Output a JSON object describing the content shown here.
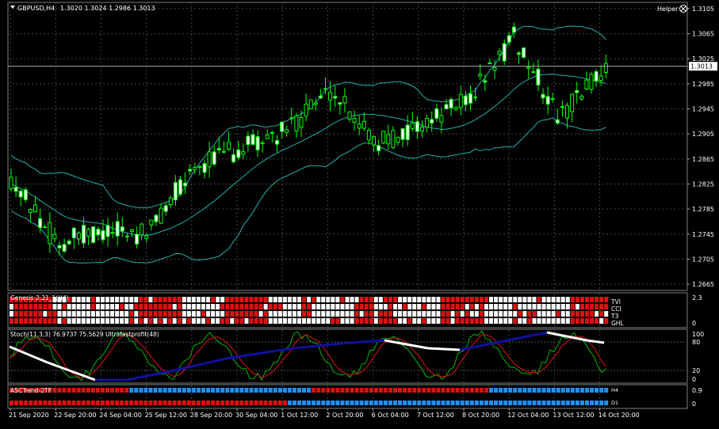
{
  "main_panel": {
    "symbol_label": "GBPUSD,H4",
    "ohlc_text": "1.3020 1.3024 1.2986 1.3013",
    "helper_label": "Helper",
    "current_price_label": "1.3013",
    "price_ticks": [
      "1.3105",
      "1.3065",
      "1.3025",
      "1.2985",
      "1.2945",
      "1.2905",
      "1.2865",
      "1.2825",
      "1.2785",
      "1.2745",
      "1.2705",
      "1.2665"
    ],
    "price_axis": {
      "min": 1.2655,
      "max": 1.3115,
      "current": 1.3013
    }
  },
  "genesis_panel": {
    "title": "Genesis 2.21_1(H4)",
    "axis_top": "2.3",
    "axis_bottom": "0",
    "row_labels": [
      "TVI",
      "CCI",
      "T3",
      "GHL"
    ]
  },
  "stoch_panel": {
    "title": "Stoch(11,3,3) 76.9737 75.5629  Ultrafastprofit(48)",
    "levels": [
      "100",
      "80",
      "20",
      "0"
    ]
  },
  "asc_panel": {
    "title": "ASCTrend-2TF",
    "axis_top": "0.9",
    "axis_bottom": "0",
    "row_labels": [
      "H4",
      "D1"
    ]
  },
  "time_axis": {
    "labels": [
      "21 Sep 2020",
      "22 Sep 20:00",
      "24 Sep 04:00",
      "25 Sep 12:00",
      "28 Sep 20:00",
      "30 Sep 04:00",
      "1 Oct 12:00",
      "2 Oct 20:00",
      "6 Oct 04:00",
      "7 Oct 12:00",
      "8 Oct 20:00",
      "12 Oct 04:00",
      "13 Oct 12:00",
      "14 Oct 20:00"
    ]
  },
  "colors": {
    "background": "#000000",
    "grid": "#3a4a3a",
    "candle": "#00ff00",
    "bollinger": "#20b2aa",
    "signal_red": "#e01010",
    "signal_white": "#ffffff",
    "signal_blue": "#1e90ff",
    "stoch_main": "#00b400",
    "stoch_signal": "#e01010",
    "ultrafast_up": "#1010a0",
    "ultrafast_flat": "#ffffff"
  },
  "chart_data": {
    "type": "candlestick",
    "title": "GBPUSD,H4",
    "x": [
      "21 Sep 2020",
      "22 Sep 20:00",
      "24 Sep 04:00",
      "25 Sep 12:00",
      "28 Sep 20:00",
      "30 Sep 04:00",
      "1 Oct 12:00",
      "2 Oct 20:00",
      "6 Oct 04:00",
      "7 Oct 12:00",
      "8 Oct 20:00",
      "12 Oct 04:00",
      "13 Oct 12:00",
      "14 Oct 20:00"
    ],
    "close": [
      1.2835,
      1.273,
      1.275,
      1.2745,
      1.2855,
      1.288,
      1.291,
      1.2975,
      1.289,
      1.292,
      1.296,
      1.306,
      1.293,
      1.3013
    ],
    "ylim": [
      1.2655,
      1.3115
    ],
    "ylabel": "",
    "xlabel": "",
    "grid": true,
    "overlays": [
      "Bollinger Bands"
    ],
    "last_price": 1.3013
  }
}
